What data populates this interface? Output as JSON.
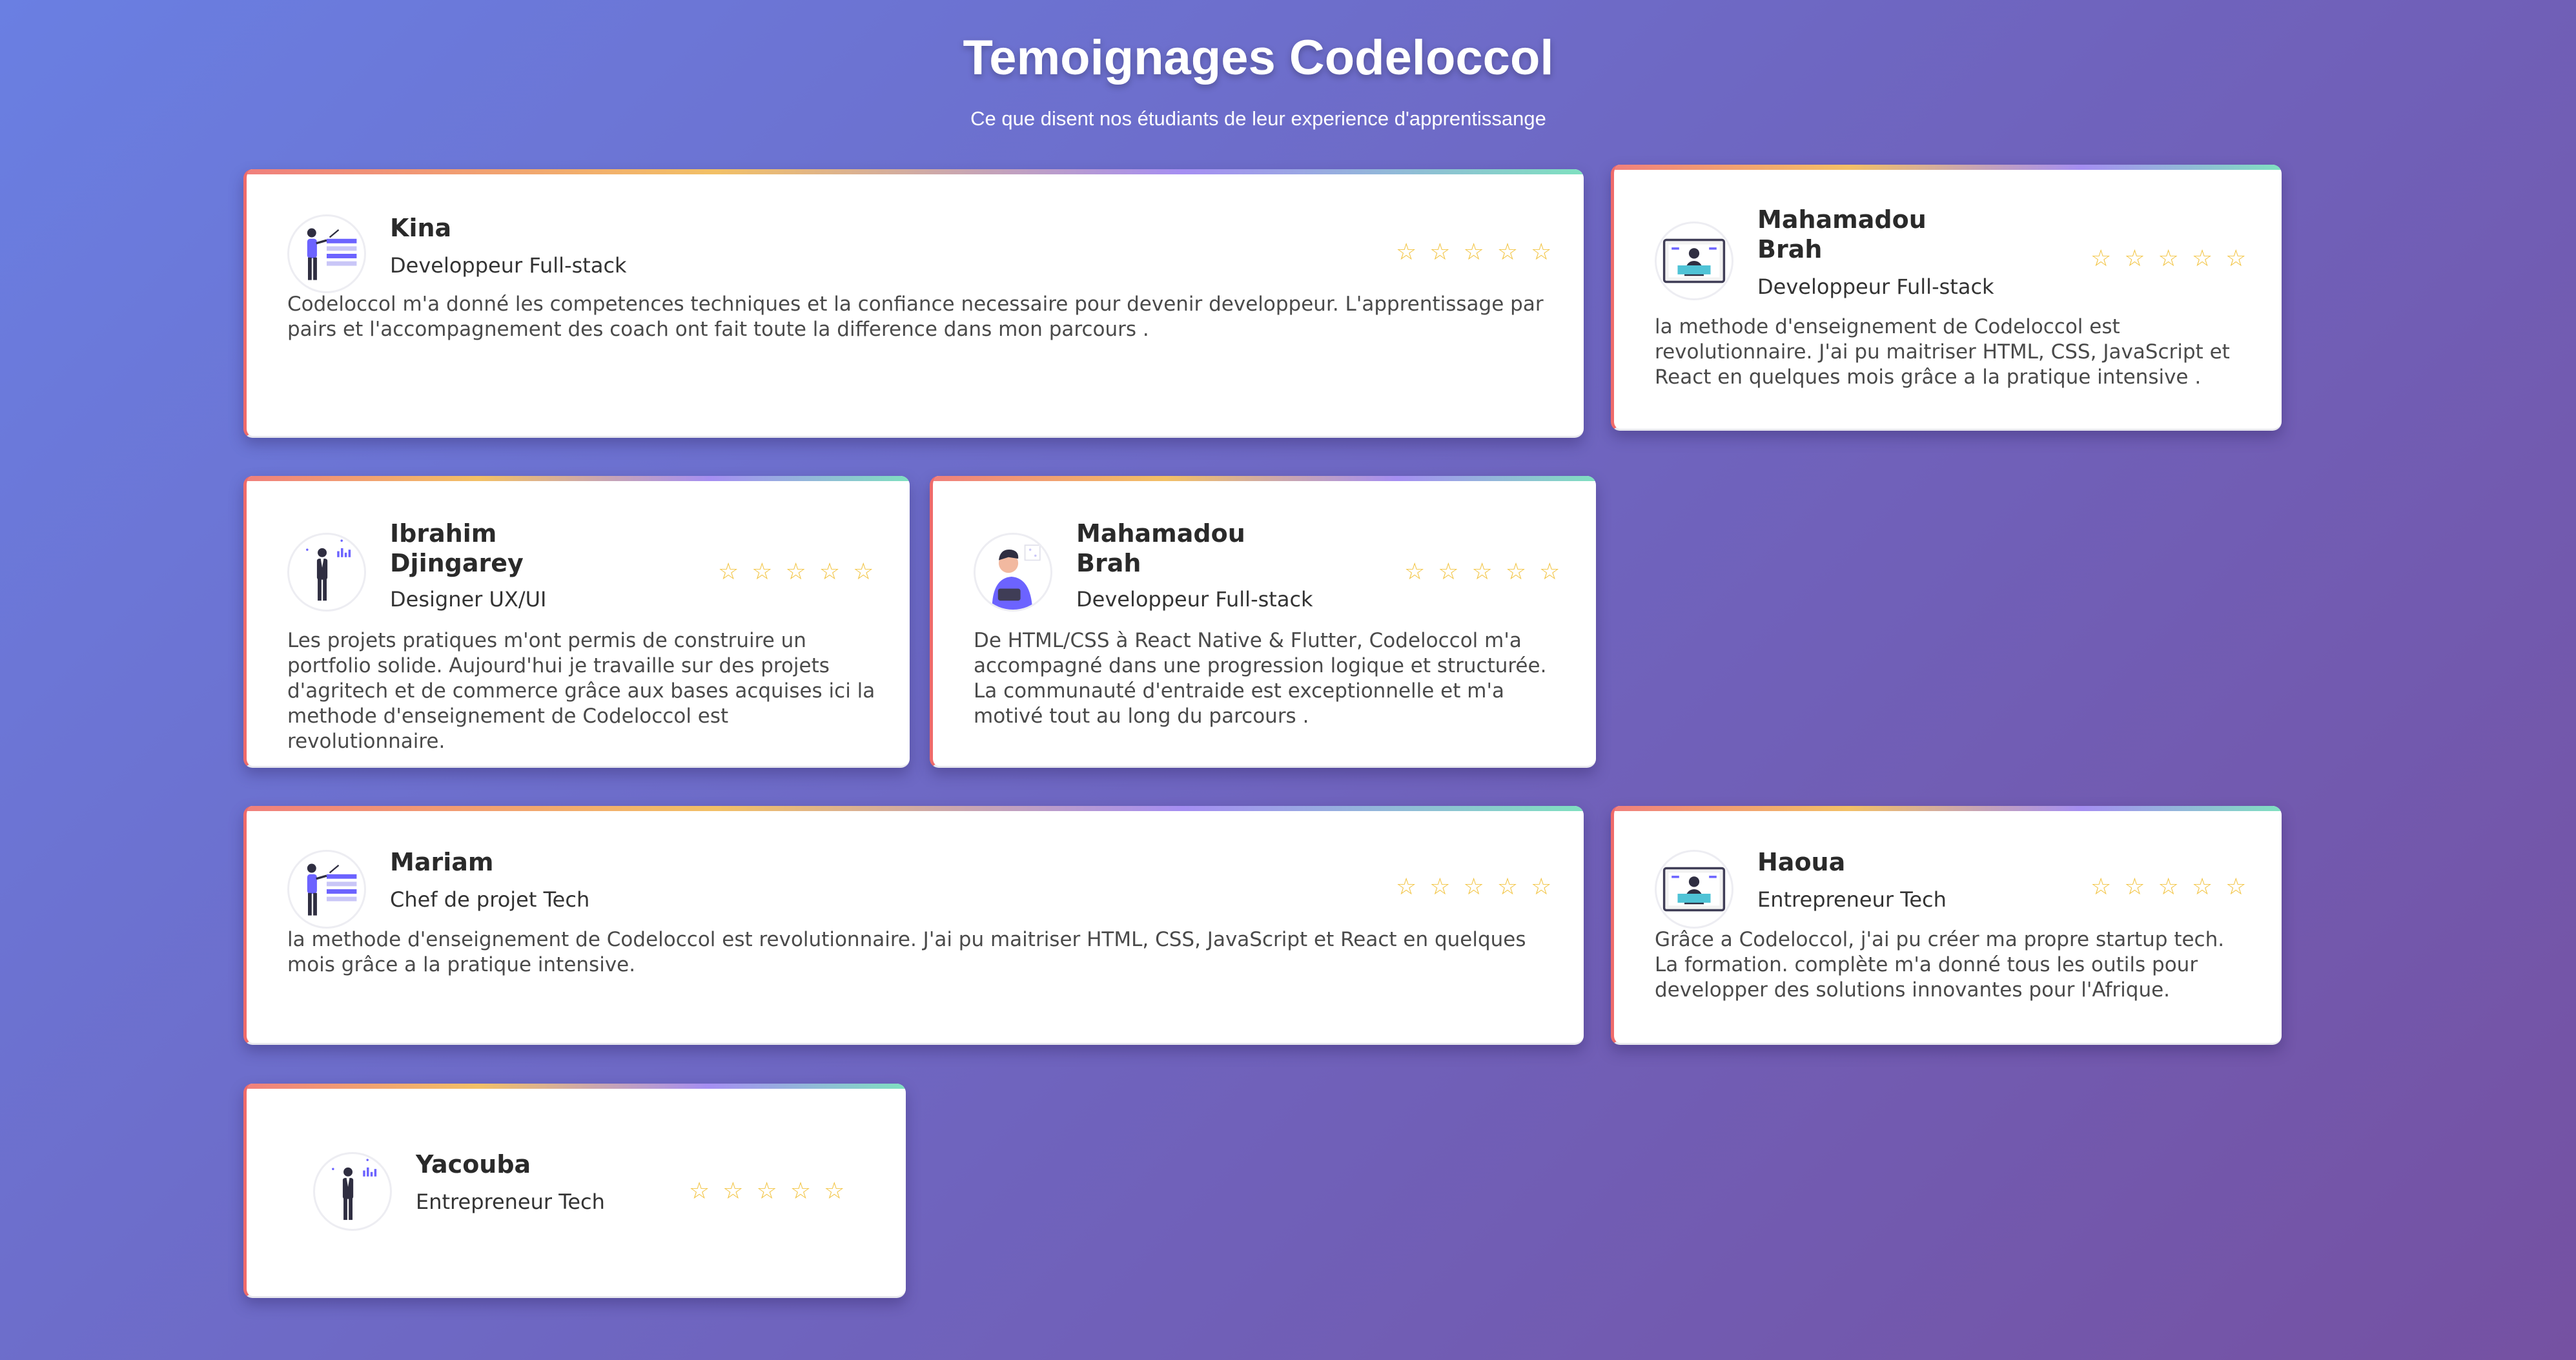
{
  "header": {
    "title": "Temoignages Codeloccol",
    "subtitle": "Ce que disent nos étudiants de leur experience d'apprentissange"
  },
  "colors": {
    "star": "#f2c33f",
    "accent": "#ef6b6b",
    "avatar_accent": "#6c63ff"
  },
  "testimonials": [
    {
      "name": "Kina",
      "role": "Developpeur Full-stack",
      "rating": 5,
      "stars": "☆☆☆☆☆",
      "avatar_icon": "person-with-laptop-board-icon",
      "text": "Codeloccol m'a donné les competences techniques et la confiance necessaire pour devenir developpeur. L'apprentissage par pairs et l'accompagnement des coach ont fait toute la difference dans mon parcours ."
    },
    {
      "name": "Mahamadou Brah",
      "role": "Developpeur Full-stack",
      "rating": 5,
      "stars": "☆☆☆☆☆",
      "avatar_icon": "person-at-monitor-icon",
      "text": "la methode d'enseignement de Codeloccol est revolutionnaire. J'ai pu maitriser HTML, CSS, JavaScript et React en quelques mois grâce a la pratique intensive ."
    },
    {
      "name": "Ibrahim Djingarey",
      "role": "Designer UX/UI",
      "rating": 5,
      "stars": "☆☆☆☆☆",
      "avatar_icon": "businessman-standing-icon",
      "text": "Les projets pratiques m'ont permis de construire un portfolio solide. Aujourd'hui je travaille sur des projets d'agritech et de commerce grâce aux bases acquises ici la methode d'enseignement de Codeloccol est revolutionnaire."
    },
    {
      "name": "Mahamadou Brah",
      "role": "Developpeur Full-stack",
      "rating": 5,
      "stars": "☆☆☆☆☆",
      "avatar_icon": "man-with-headset-icon",
      "text": "De HTML/CSS à React Native & Flutter, Codeloccol m'a accompagné dans une progression logique et structurée. La communauté d'entraide est exceptionnelle et m'a motivé tout au long du parcours ."
    },
    {
      "name": "Mariam",
      "role": "Chef de projet Tech",
      "rating": 5,
      "stars": "☆☆☆☆☆",
      "avatar_icon": "person-with-laptop-board-icon",
      "text": "la methode d'enseignement de Codeloccol est revolutionnaire. J'ai pu maitriser HTML, CSS, JavaScript et React en quelques mois grâce a la pratique intensive."
    },
    {
      "name": "Haoua",
      "role": "Entrepreneur Tech",
      "rating": 5,
      "stars": "☆☆☆☆☆",
      "avatar_icon": "person-at-monitor-icon",
      "text": "Grâce a Codeloccol, j'ai pu créer ma propre startup tech. La formation. complète m'a donné tous les outils pour developper des solutions innovantes pour l'Afrique."
    },
    {
      "name": "Yacouba",
      "role": "Entrepreneur Tech",
      "rating": 5,
      "stars": "☆☆☆☆☆",
      "avatar_icon": "businessman-standing-icon",
      "text": ""
    }
  ]
}
